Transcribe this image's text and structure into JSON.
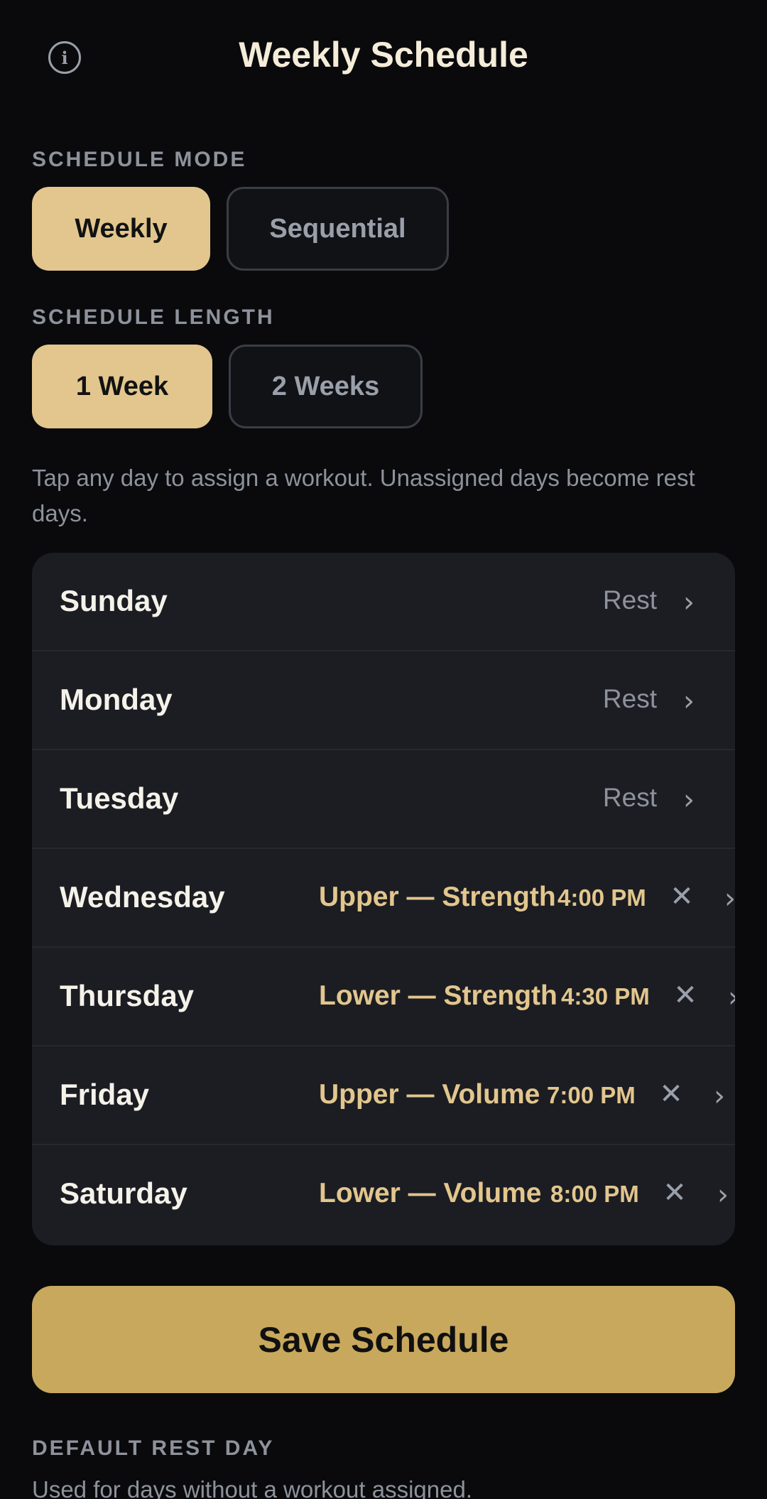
{
  "header": {
    "title": "Weekly Schedule",
    "info_icon": "i"
  },
  "schedule_mode": {
    "label": "SCHEDULE MODE",
    "options": [
      "Weekly",
      "Sequential"
    ],
    "selected": "Weekly"
  },
  "schedule_length": {
    "label": "SCHEDULE LENGTH",
    "options": [
      "1 Week",
      "2 Weeks"
    ],
    "selected": "1 Week"
  },
  "help_text": "Tap any day to assign a workout. Unassigned days become rest days.",
  "days": [
    {
      "name": "Sunday",
      "status": "Rest"
    },
    {
      "name": "Monday",
      "status": "Rest"
    },
    {
      "name": "Tuesday",
      "status": "Rest"
    },
    {
      "name": "Wednesday",
      "workout": "Upper — Strength",
      "time": "4:00 PM"
    },
    {
      "name": "Thursday",
      "workout": "Lower — Strength",
      "time": "4:30 PM"
    },
    {
      "name": "Friday",
      "workout": "Upper — Volume",
      "time": "7:00 PM"
    },
    {
      "name": "Saturday",
      "workout": "Lower — Volume",
      "time": "8:00 PM"
    }
  ],
  "icons": {
    "chevron": "›",
    "clear": "✕"
  },
  "save_button": "Save Schedule",
  "default_rest_day": {
    "label": "DEFAULT REST DAY",
    "subtext": "Used for days without a workout assigned."
  },
  "colors": {
    "accent": "#e2c68d",
    "save": "#c8a85c",
    "background": "#0a0a0c",
    "card": "#1c1d23"
  }
}
